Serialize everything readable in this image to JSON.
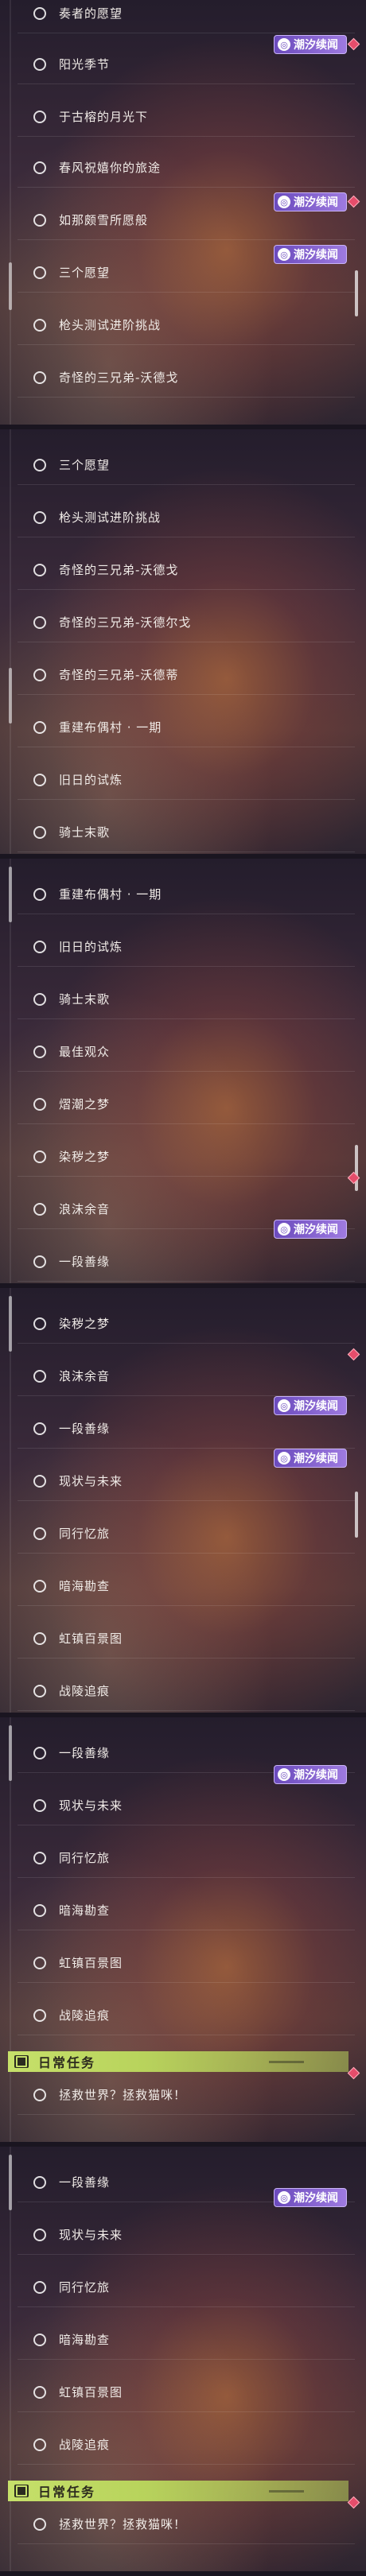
{
  "badge_label": "潮汐续闻",
  "section_title": "日常任务",
  "panels": [
    {
      "items": [
        "奏者的愿望",
        "阳光季节",
        "于古榕的月光下",
        "春风祝嬉你的旅途",
        "如那颇雪所愿般",
        "三个愿望",
        "枪头测试进阶挑战",
        "奇怪的三兄弟-沃德戈"
      ]
    },
    {
      "items": [
        "三个愿望",
        "枪头测试进阶挑战",
        "奇怪的三兄弟-沃德戈",
        "奇怪的三兄弟-沃德尔戈",
        "奇怪的三兄弟-沃德蒂",
        "重建布偶村 · 一期",
        "旧日的试炼",
        "骑士末歌"
      ]
    },
    {
      "items": [
        "重建布偶村 · 一期",
        "旧日的试炼",
        "骑士末歌",
        "最佳观众",
        "熠潮之梦",
        "染秽之梦",
        "浪沫余音",
        "一段善缘"
      ]
    },
    {
      "items": [
        "染秽之梦",
        "浪沫余音",
        "一段善缘",
        "现状与未来",
        "同行忆旅",
        "暗海勘查",
        "虹镇百景图",
        "战陵追痕"
      ]
    },
    {
      "items": [
        "一段善缘",
        "现状与未来",
        "同行忆旅",
        "暗海勘查",
        "虹镇百景图",
        "战陵追痕"
      ],
      "daily": "拯救世界？拯救猫咪！"
    },
    {
      "items": [
        "一段善缘",
        "现状与未来",
        "同行忆旅",
        "暗海勘查",
        "虹镇百景图",
        "战陵追痕"
      ],
      "daily": "拯救世界？拯救猫咪！"
    }
  ]
}
